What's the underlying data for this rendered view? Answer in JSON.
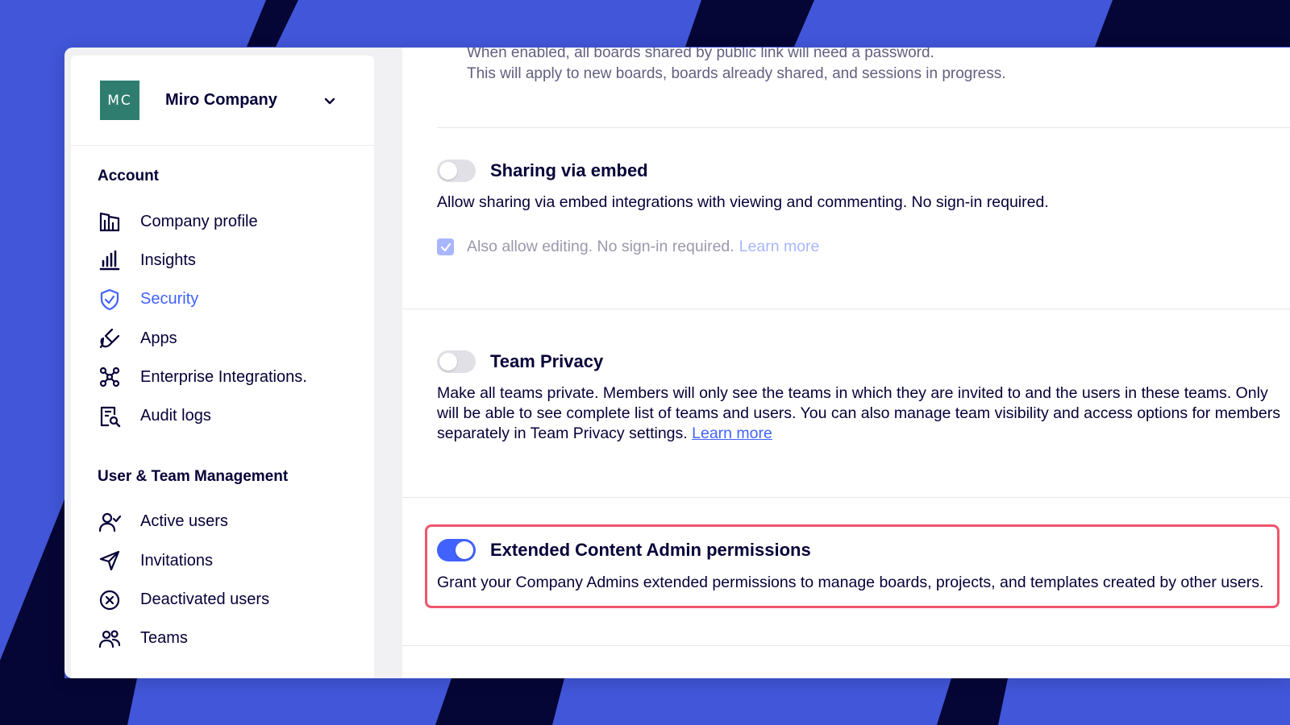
{
  "colors": {
    "background_blue": "#4156d8",
    "stripe_navy": "#060636",
    "accent": "#4262ff",
    "text_primary": "#050038",
    "highlight_red": "#f0566c",
    "org_avatar": "#2f7d6e"
  },
  "org": {
    "initials": "MC",
    "name": "Miro Company",
    "dropdown_icon": "chevron-down-icon"
  },
  "sidebar": {
    "account_title": "Account",
    "account_items": [
      {
        "label": "Company profile",
        "icon": "building-icon"
      },
      {
        "label": "Insights",
        "icon": "bar-chart-icon"
      },
      {
        "label": "Security",
        "icon": "shield-check-icon",
        "active": true
      },
      {
        "label": "Apps",
        "icon": "plug-icon"
      },
      {
        "label": "Enterprise Integrations.",
        "icon": "network-icon"
      },
      {
        "label": "Audit logs",
        "icon": "document-search-icon"
      }
    ],
    "users_title": "User & Team Management",
    "users_items": [
      {
        "label": "Active users",
        "icon": "user-check-icon"
      },
      {
        "label": "Invitations",
        "icon": "send-icon"
      },
      {
        "label": "Deactivated users",
        "icon": "circle-x-icon"
      },
      {
        "label": "Teams",
        "icon": "users-icon"
      }
    ]
  },
  "main": {
    "password_desc_line1": "When enabled, all boards shared by public link will need a password.",
    "password_desc_line2": "This will apply to new boards, boards already shared, and sessions in progress.",
    "embed": {
      "title": "Sharing via embed",
      "enabled": false,
      "desc": "Allow sharing via embed integrations with viewing and commenting. No sign-in required.",
      "checkbox_label": "Also allow editing. No sign-in required.",
      "checkbox_checked": true,
      "learn_more": "Learn more"
    },
    "team_privacy": {
      "title": "Team Privacy",
      "enabled": false,
      "desc_line1": "Make all teams private. Members will only see the teams in which they are invited to and the users in these teams. Only",
      "desc_line2": "will be able to see complete list of teams and users. You can also manage team visibility and access options for members",
      "desc_line3": "separately in Team Privacy settings.",
      "learn_more": "Learn more"
    },
    "extended_admin": {
      "title": "Extended Content Admin permissions",
      "enabled": true,
      "desc": "Grant your Company Admins extended permissions to manage boards, projects, and templates created by other users."
    }
  }
}
